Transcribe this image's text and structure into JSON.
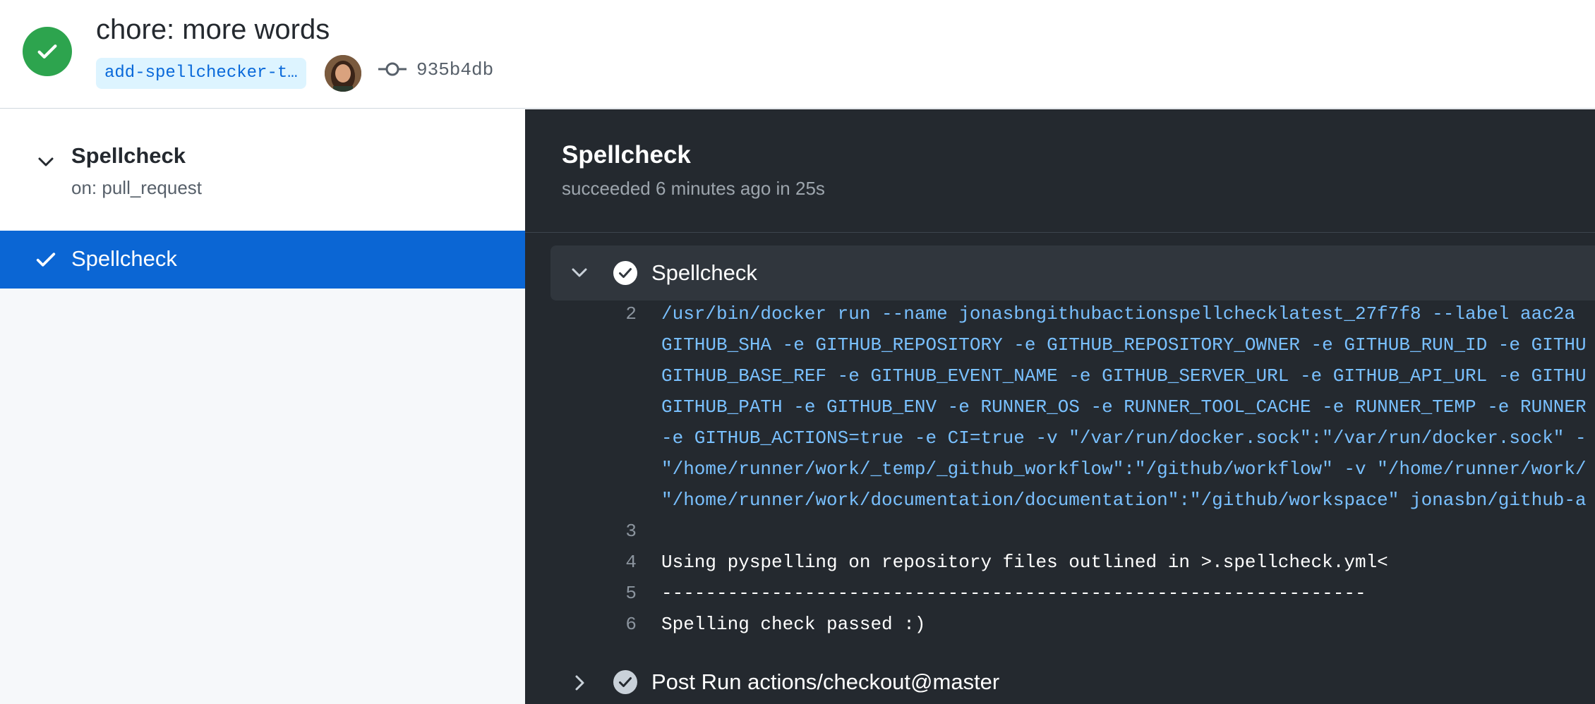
{
  "header": {
    "title": "chore: more words",
    "branch": "add-spellchecker-t…",
    "commit_sha": "935b4db",
    "status_color": "#2da44e"
  },
  "sidebar": {
    "workflow_name": "Spellcheck",
    "workflow_trigger": "on: pull_request",
    "jobs": [
      {
        "label": "Spellcheck",
        "status": "success",
        "selected": true
      }
    ],
    "selected_color": "#0b66d4"
  },
  "job": {
    "title": "Spellcheck",
    "status_text": "succeeded 6 minutes ago in 25s"
  },
  "steps": [
    {
      "name": "Spellcheck",
      "expanded": true,
      "log": [
        {
          "num": "2",
          "text": "/usr/bin/docker run --name jonasbngithubactionspellchecklatest_27f7f8 --label aac2a",
          "kind": "cmd"
        },
        {
          "num": "",
          "text": "GITHUB_SHA -e GITHUB_REPOSITORY -e GITHUB_REPOSITORY_OWNER -e GITHUB_RUN_ID -e GITHU",
          "kind": "cmd"
        },
        {
          "num": "",
          "text": "GITHUB_BASE_REF -e GITHUB_EVENT_NAME -e GITHUB_SERVER_URL -e GITHUB_API_URL -e GITHU",
          "kind": "cmd"
        },
        {
          "num": "",
          "text": "GITHUB_PATH -e GITHUB_ENV -e RUNNER_OS -e RUNNER_TOOL_CACHE -e RUNNER_TEMP -e RUNNER",
          "kind": "cmd"
        },
        {
          "num": "",
          "text": "-e GITHUB_ACTIONS=true -e CI=true -v \"/var/run/docker.sock\":\"/var/run/docker.sock\" -",
          "kind": "cmd"
        },
        {
          "num": "",
          "text": "\"/home/runner/work/_temp/_github_workflow\":\"/github/workflow\" -v \"/home/runner/work/",
          "kind": "cmd"
        },
        {
          "num": "",
          "text": "\"/home/runner/work/documentation/documentation\":\"/github/workspace\" jonasbn/github-a",
          "kind": "cmd"
        },
        {
          "num": "3",
          "text": "",
          "kind": "plain"
        },
        {
          "num": "4",
          "text": "Using pyspelling on repository files outlined in >.spellcheck.yml<",
          "kind": "plain"
        },
        {
          "num": "5",
          "text": "----------------------------------------------------------------",
          "kind": "plain"
        },
        {
          "num": "6",
          "text": "Spelling check passed :)",
          "kind": "plain"
        }
      ]
    },
    {
      "name": "Post Run actions/checkout@master",
      "expanded": false
    }
  ],
  "icons": {
    "status": "check-circle-icon",
    "commit": "git-commit-icon",
    "chevron_down": "chevron-down-icon",
    "chevron_right": "chevron-right-icon",
    "check": "check-icon"
  }
}
